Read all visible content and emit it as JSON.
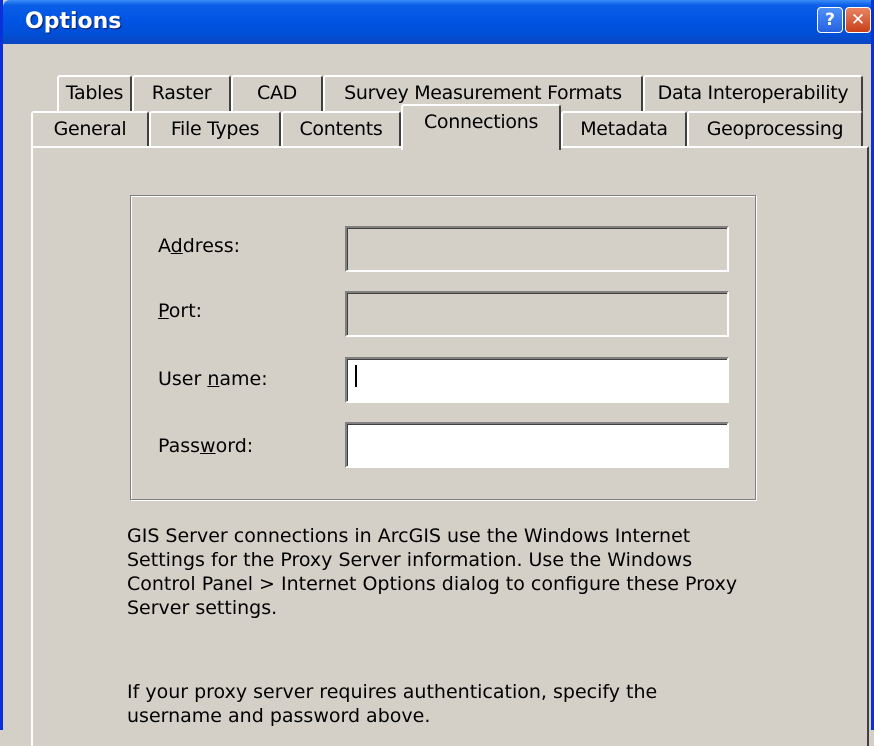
{
  "window": {
    "title": "Options",
    "help_glyph": "?",
    "close_glyph": "✕"
  },
  "tabs": {
    "row_back": [
      {
        "label": "Tables"
      },
      {
        "label": "Raster"
      },
      {
        "label": "CAD"
      },
      {
        "label": "Survey Measurement Formats"
      },
      {
        "label": "Data Interoperability"
      }
    ],
    "row_front": [
      {
        "label": "General"
      },
      {
        "label": "File Types"
      },
      {
        "label": "Contents"
      },
      {
        "label": "Connections",
        "active": true
      },
      {
        "label": "Metadata"
      },
      {
        "label": "Geoprocessing"
      }
    ]
  },
  "form": {
    "address": {
      "label_pre": "A",
      "label_key": "d",
      "label_post": "dress:",
      "value": "",
      "enabled": false
    },
    "port": {
      "label_pre": "",
      "label_key": "P",
      "label_post": "ort:",
      "value": "",
      "enabled": false
    },
    "username": {
      "label_pre": "User ",
      "label_key": "n",
      "label_post": "ame:",
      "value": "",
      "enabled": true
    },
    "password": {
      "label_pre": "Pass",
      "label_key": "w",
      "label_post": "ord:",
      "value": "",
      "enabled": true
    }
  },
  "notes": {
    "proxy_line1": "GIS Server connections in ArcGIS use the Windows Internet",
    "proxy_line2": "Settings for the Proxy Server information. Use the Windows",
    "proxy_line3": "Control Panel > Internet Options dialog to configure these Proxy",
    "proxy_line4": "Server settings.",
    "auth_line1": "If your proxy server requires authentication, specify the",
    "auth_line2": "username and password above."
  },
  "colors": {
    "titlebar": "#0054e3",
    "dialog_face": "#d4d0c8",
    "close_button": "#c8401a"
  }
}
